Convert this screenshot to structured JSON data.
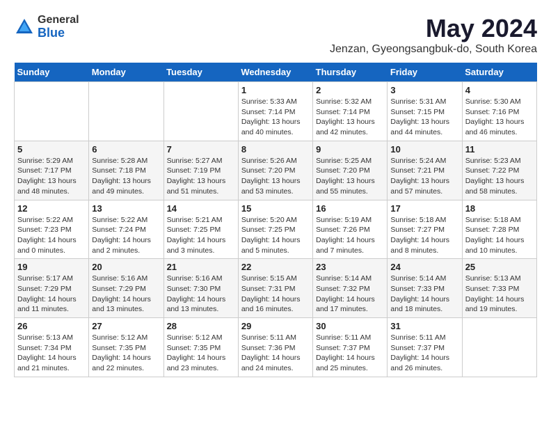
{
  "logo": {
    "general": "General",
    "blue": "Blue"
  },
  "title": "May 2024",
  "location": "Jenzan, Gyeongsangbuk-do, South Korea",
  "days_of_week": [
    "Sunday",
    "Monday",
    "Tuesday",
    "Wednesday",
    "Thursday",
    "Friday",
    "Saturday"
  ],
  "weeks": [
    [
      {
        "day": "",
        "info": ""
      },
      {
        "day": "",
        "info": ""
      },
      {
        "day": "",
        "info": ""
      },
      {
        "day": "1",
        "info": "Sunrise: 5:33 AM\nSunset: 7:14 PM\nDaylight: 13 hours\nand 40 minutes."
      },
      {
        "day": "2",
        "info": "Sunrise: 5:32 AM\nSunset: 7:14 PM\nDaylight: 13 hours\nand 42 minutes."
      },
      {
        "day": "3",
        "info": "Sunrise: 5:31 AM\nSunset: 7:15 PM\nDaylight: 13 hours\nand 44 minutes."
      },
      {
        "day": "4",
        "info": "Sunrise: 5:30 AM\nSunset: 7:16 PM\nDaylight: 13 hours\nand 46 minutes."
      }
    ],
    [
      {
        "day": "5",
        "info": "Sunrise: 5:29 AM\nSunset: 7:17 PM\nDaylight: 13 hours\nand 48 minutes."
      },
      {
        "day": "6",
        "info": "Sunrise: 5:28 AM\nSunset: 7:18 PM\nDaylight: 13 hours\nand 49 minutes."
      },
      {
        "day": "7",
        "info": "Sunrise: 5:27 AM\nSunset: 7:19 PM\nDaylight: 13 hours\nand 51 minutes."
      },
      {
        "day": "8",
        "info": "Sunrise: 5:26 AM\nSunset: 7:20 PM\nDaylight: 13 hours\nand 53 minutes."
      },
      {
        "day": "9",
        "info": "Sunrise: 5:25 AM\nSunset: 7:20 PM\nDaylight: 13 hours\nand 55 minutes."
      },
      {
        "day": "10",
        "info": "Sunrise: 5:24 AM\nSunset: 7:21 PM\nDaylight: 13 hours\nand 57 minutes."
      },
      {
        "day": "11",
        "info": "Sunrise: 5:23 AM\nSunset: 7:22 PM\nDaylight: 13 hours\nand 58 minutes."
      }
    ],
    [
      {
        "day": "12",
        "info": "Sunrise: 5:22 AM\nSunset: 7:23 PM\nDaylight: 14 hours\nand 0 minutes."
      },
      {
        "day": "13",
        "info": "Sunrise: 5:22 AM\nSunset: 7:24 PM\nDaylight: 14 hours\nand 2 minutes."
      },
      {
        "day": "14",
        "info": "Sunrise: 5:21 AM\nSunset: 7:25 PM\nDaylight: 14 hours\nand 3 minutes."
      },
      {
        "day": "15",
        "info": "Sunrise: 5:20 AM\nSunset: 7:25 PM\nDaylight: 14 hours\nand 5 minutes."
      },
      {
        "day": "16",
        "info": "Sunrise: 5:19 AM\nSunset: 7:26 PM\nDaylight: 14 hours\nand 7 minutes."
      },
      {
        "day": "17",
        "info": "Sunrise: 5:18 AM\nSunset: 7:27 PM\nDaylight: 14 hours\nand 8 minutes."
      },
      {
        "day": "18",
        "info": "Sunrise: 5:18 AM\nSunset: 7:28 PM\nDaylight: 14 hours\nand 10 minutes."
      }
    ],
    [
      {
        "day": "19",
        "info": "Sunrise: 5:17 AM\nSunset: 7:29 PM\nDaylight: 14 hours\nand 11 minutes."
      },
      {
        "day": "20",
        "info": "Sunrise: 5:16 AM\nSunset: 7:29 PM\nDaylight: 14 hours\nand 13 minutes."
      },
      {
        "day": "21",
        "info": "Sunrise: 5:16 AM\nSunset: 7:30 PM\nDaylight: 14 hours\nand 13 minutes."
      },
      {
        "day": "22",
        "info": "Sunrise: 5:15 AM\nSunset: 7:31 PM\nDaylight: 14 hours\nand 16 minutes."
      },
      {
        "day": "23",
        "info": "Sunrise: 5:14 AM\nSunset: 7:32 PM\nDaylight: 14 hours\nand 17 minutes."
      },
      {
        "day": "24",
        "info": "Sunrise: 5:14 AM\nSunset: 7:33 PM\nDaylight: 14 hours\nand 18 minutes."
      },
      {
        "day": "25",
        "info": "Sunrise: 5:13 AM\nSunset: 7:33 PM\nDaylight: 14 hours\nand 19 minutes."
      }
    ],
    [
      {
        "day": "26",
        "info": "Sunrise: 5:13 AM\nSunset: 7:34 PM\nDaylight: 14 hours\nand 21 minutes."
      },
      {
        "day": "27",
        "info": "Sunrise: 5:12 AM\nSunset: 7:35 PM\nDaylight: 14 hours\nand 22 minutes."
      },
      {
        "day": "28",
        "info": "Sunrise: 5:12 AM\nSunset: 7:35 PM\nDaylight: 14 hours\nand 23 minutes."
      },
      {
        "day": "29",
        "info": "Sunrise: 5:11 AM\nSunset: 7:36 PM\nDaylight: 14 hours\nand 24 minutes."
      },
      {
        "day": "30",
        "info": "Sunrise: 5:11 AM\nSunset: 7:37 PM\nDaylight: 14 hours\nand 25 minutes."
      },
      {
        "day": "31",
        "info": "Sunrise: 5:11 AM\nSunset: 7:37 PM\nDaylight: 14 hours\nand 26 minutes."
      },
      {
        "day": "",
        "info": ""
      }
    ]
  ]
}
